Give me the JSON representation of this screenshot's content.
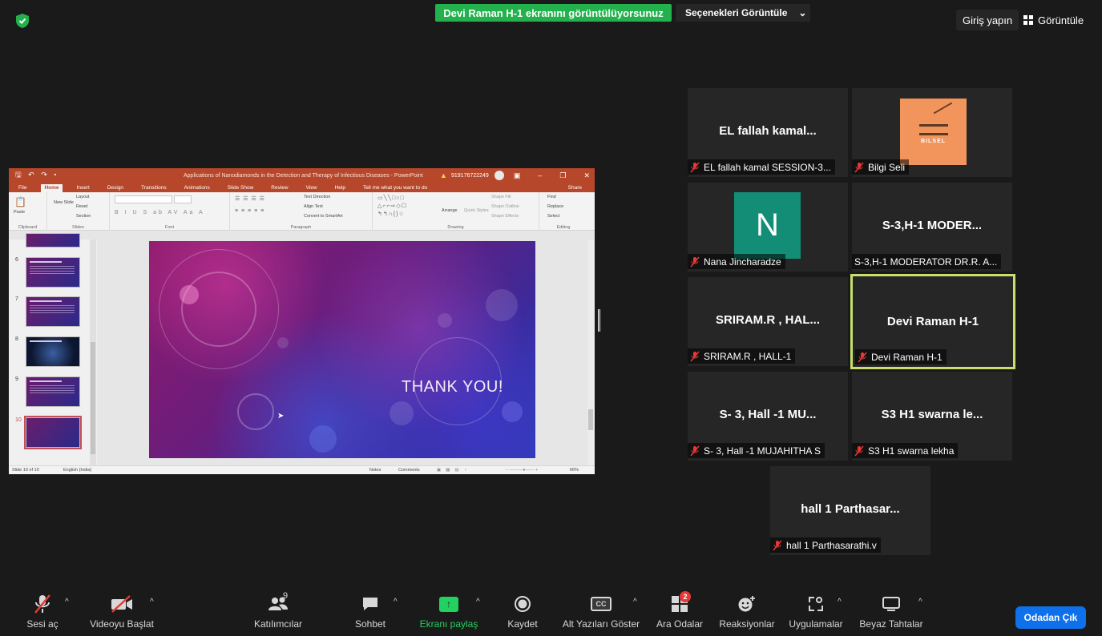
{
  "top": {
    "share_banner": "Devi Raman H-1 ekranını görüntülüyorsunuz",
    "view_options": "Seçenekleri Görüntüle",
    "signin": "Giriş yapın",
    "view": "Görüntüle"
  },
  "powerpoint": {
    "doc_title": "Applications of Nanodiamonds in the Detection and Therapy of Infectious Diseases  -  PowerPoint",
    "phone": "919176722249",
    "tabs": [
      "File",
      "Home",
      "Insert",
      "Design",
      "Transitions",
      "Animations",
      "Slide Show",
      "Review",
      "View",
      "Help",
      "Tell me what you want to do"
    ],
    "share": "Share",
    "ribbon": {
      "paste": "Paste",
      "new_slide": "New Slide",
      "layout": "Layout",
      "reset": "Reset",
      "section": "Section",
      "text_direction": "Text Direction",
      "align_text": "Align Text",
      "smartart": "Convert to SmartArt",
      "arrange": "Arrange",
      "quick_styles": "Quick Styles",
      "shape_fill": "Shape Fill",
      "shape_outline": "Shape Outline",
      "shape_effects": "Shape Effects",
      "find": "Find",
      "replace": "Replace",
      "select": "Select",
      "groups": [
        "Clipboard",
        "Slides",
        "Font",
        "Paragraph",
        "Drawing",
        "Editing"
      ]
    },
    "thumb_numbers": [
      "6",
      "7",
      "8",
      "9",
      "10"
    ],
    "slide_text": "THANK YOU!",
    "status": {
      "slide_count": "Slide 10 of 10",
      "language": "English (India)",
      "notes": "Notes",
      "comments": "Comments",
      "zoom": "66%"
    }
  },
  "tiles": [
    {
      "display": "EL fallah kamal...",
      "label": "EL fallah kamal  SESSION-3..."
    },
    {
      "display": "",
      "label": "Bilgi Seli",
      "logo_text": "BILSEL"
    },
    {
      "display": "",
      "label": "Nana Jincharadze",
      "avatar": "N"
    },
    {
      "display": "S-3,H-1  MODER...",
      "label": "S-3,H-1 MODERATOR DR.R. A..."
    },
    {
      "display": "SRIRAM.R , HAL...",
      "label": "SRIRAM.R , HALL-1"
    },
    {
      "display": "Devi Raman H-1",
      "label": "Devi Raman H-1"
    },
    {
      "display": "S- 3, Hall -1 MU...",
      "label": "S- 3, Hall -1 MUJAHITHA S"
    },
    {
      "display": "S3 H1 swarna le...",
      "label": "S3 H1 swarna lekha"
    },
    {
      "display": "hall 1 Parthasar...",
      "label": "hall 1 Parthasarathi.v"
    }
  ],
  "toolbar": {
    "unmute": "Sesi aç",
    "start_video": "Videoyu Başlat",
    "participants": "Katılımcılar",
    "participants_count": "9",
    "chat": "Sohbet",
    "share_screen": "Ekranı paylaş",
    "record": "Kaydet",
    "captions": "Alt Yazıları Göster",
    "captions_icon": "CC",
    "breakout": "Ara Odalar",
    "breakout_badge": "2",
    "reactions": "Reaksiyonlar",
    "apps": "Uygulamalar",
    "whiteboards": "Beyaz Tahtalar",
    "leave": "Odadan Çık"
  },
  "colors": {
    "share_green": "#23b14d",
    "active_speaker": "#c8df6d",
    "leave_blue": "#0e71eb",
    "powerpoint_red": "#b7472a"
  }
}
